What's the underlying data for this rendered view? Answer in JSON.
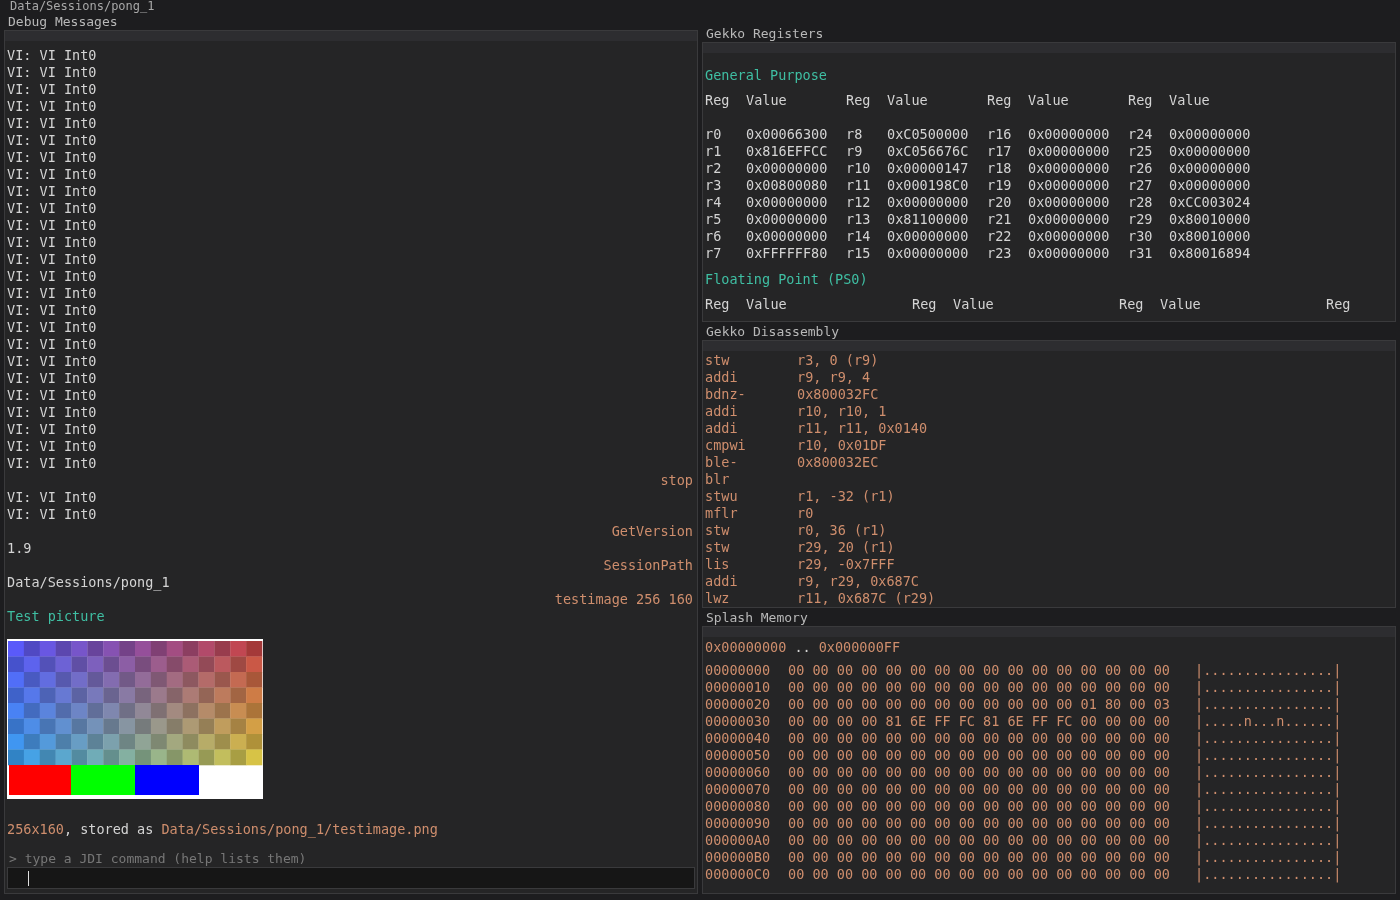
{
  "path_header": "Data/Sessions/pong_1",
  "debug_panel": {
    "title": "Debug Messages",
    "entries": [
      {
        "kind": "log",
        "text": "VI: VI Int0"
      },
      {
        "kind": "log",
        "text": "VI: VI Int0"
      },
      {
        "kind": "log",
        "text": "VI: VI Int0"
      },
      {
        "kind": "log",
        "text": "VI: VI Int0"
      },
      {
        "kind": "log",
        "text": "VI: VI Int0"
      },
      {
        "kind": "log",
        "text": "VI: VI Int0"
      },
      {
        "kind": "log",
        "text": "VI: VI Int0"
      },
      {
        "kind": "log",
        "text": "VI: VI Int0"
      },
      {
        "kind": "log",
        "text": "VI: VI Int0"
      },
      {
        "kind": "log",
        "text": "VI: VI Int0"
      },
      {
        "kind": "log",
        "text": "VI: VI Int0"
      },
      {
        "kind": "log",
        "text": "VI: VI Int0"
      },
      {
        "kind": "log",
        "text": "VI: VI Int0"
      },
      {
        "kind": "log",
        "text": "VI: VI Int0"
      },
      {
        "kind": "log",
        "text": "VI: VI Int0"
      },
      {
        "kind": "log",
        "text": "VI: VI Int0"
      },
      {
        "kind": "log",
        "text": "VI: VI Int0"
      },
      {
        "kind": "log",
        "text": "VI: VI Int0"
      },
      {
        "kind": "log",
        "text": "VI: VI Int0"
      },
      {
        "kind": "log",
        "text": "VI: VI Int0"
      },
      {
        "kind": "log",
        "text": "VI: VI Int0"
      },
      {
        "kind": "log",
        "text": "VI: VI Int0"
      },
      {
        "kind": "log",
        "text": "VI: VI Int0"
      },
      {
        "kind": "log",
        "text": "VI: VI Int0"
      },
      {
        "kind": "log",
        "text": "VI: VI Int0"
      },
      {
        "kind": "command",
        "text": "stop"
      },
      {
        "kind": "log",
        "text": "VI: VI Int0"
      },
      {
        "kind": "log",
        "text": "VI: VI Int0"
      },
      {
        "kind": "command",
        "text": "GetVersion"
      },
      {
        "kind": "log",
        "text": "1.9"
      },
      {
        "kind": "command",
        "text": "SessionPath"
      },
      {
        "kind": "log",
        "text": "Data/Sessions/pong_1"
      },
      {
        "kind": "command",
        "text": "testimage 256 160"
      },
      {
        "kind": "heading",
        "text": "Test picture"
      },
      {
        "kind": "image"
      },
      {
        "kind": "result",
        "parts": [
          {
            "kind": "value",
            "text": "256x160"
          },
          {
            "kind": "plain",
            "text": ", stored as "
          },
          {
            "kind": "value",
            "text": "Data/Sessions/pong_1/testimage.png"
          }
        ]
      }
    ],
    "prompt_hint": "> type a JDI command (help lists them)"
  },
  "registers_panel": {
    "title": "Gekko Registers",
    "general_purpose": {
      "title": "General Purpose",
      "columns": [
        "Reg",
        "Value",
        "Reg",
        "Value",
        "Reg",
        "Value",
        "Reg",
        "Value"
      ],
      "rows": [
        [
          "r0",
          "0x00066300",
          "r8",
          "0xC0500000",
          "r16",
          "0x00000000",
          "r24",
          "0x00000000"
        ],
        [
          "r1",
          "0x816EFFCC",
          "r9",
          "0xC056676C",
          "r17",
          "0x00000000",
          "r25",
          "0x00000000"
        ],
        [
          "r2",
          "0x00000000",
          "r10",
          "0x00000147",
          "r18",
          "0x00000000",
          "r26",
          "0x00000000"
        ],
        [
          "r3",
          "0x00800080",
          "r11",
          "0x000198C0",
          "r19",
          "0x00000000",
          "r27",
          "0x00000000"
        ],
        [
          "r4",
          "0x00000000",
          "r12",
          "0x00000000",
          "r20",
          "0x00000000",
          "r28",
          "0xCC003024"
        ],
        [
          "r5",
          "0x00000000",
          "r13",
          "0x81100000",
          "r21",
          "0x00000000",
          "r29",
          "0x80010000"
        ],
        [
          "r6",
          "0x00000000",
          "r14",
          "0x00000000",
          "r22",
          "0x00000000",
          "r30",
          "0x80010000"
        ],
        [
          "r7",
          "0xFFFFFF80",
          "r15",
          "0x00000000",
          "r23",
          "0x00000000",
          "r31",
          "0x80016894"
        ]
      ]
    },
    "floating_point": {
      "title": "Floating Point (PS0)",
      "columns": [
        "Reg",
        "Value",
        "Reg",
        "Value",
        "Reg",
        "Value",
        "Reg"
      ]
    }
  },
  "disassembly_panel": {
    "title": "Gekko Disassembly",
    "rows": [
      {
        "mnemonic": "stw",
        "operands": "r3, 0 (r9)"
      },
      {
        "mnemonic": "addi",
        "operands": "r9, r9, 4"
      },
      {
        "mnemonic": "bdnz-",
        "operands": "0x800032FC"
      },
      {
        "mnemonic": "addi",
        "operands": "r10, r10, 1"
      },
      {
        "mnemonic": "addi",
        "operands": "r11, r11, 0x0140"
      },
      {
        "mnemonic": "cmpwi",
        "operands": "r10, 0x01DF"
      },
      {
        "mnemonic": "ble-",
        "operands": "0x800032EC"
      },
      {
        "mnemonic": "blr"
      },
      {
        "mnemonic": "stwu",
        "operands": "r1, -32 (r1)"
      },
      {
        "mnemonic": "mflr",
        "operands": "r0"
      },
      {
        "mnemonic": "stw",
        "operands": "r0, 36 (r1)"
      },
      {
        "mnemonic": "stw",
        "operands": "r29, 20 (r1)"
      },
      {
        "mnemonic": "lis",
        "operands": "r29, -0x7FFF"
      },
      {
        "mnemonic": "addi",
        "operands": "r9, r29, 0x687C"
      },
      {
        "mnemonic": "lwz",
        "operands": "r11, 0x687C (r29)"
      }
    ]
  },
  "memory_panel": {
    "title": "Splash Memory",
    "range_start": "0x00000000",
    "range_separator": "..",
    "range_end": "0x000000FF",
    "rows": [
      {
        "address": "00000000",
        "bytes": "00 00 00 00 00 00 00 00 00 00 00 00 00 00 00 00",
        "ascii": "|................|"
      },
      {
        "address": "00000010",
        "bytes": "00 00 00 00 00 00 00 00 00 00 00 00 00 00 00 00",
        "ascii": "|................|"
      },
      {
        "address": "00000020",
        "bytes": "00 00 00 00 00 00 00 00 00 00 00 00 01 80 00 03",
        "ascii": "|................|"
      },
      {
        "address": "00000030",
        "bytes": "00 00 00 00 81 6E FF FC 81 6E FF FC 00 00 00 00",
        "ascii": "|.....n...n......|"
      },
      {
        "address": "00000040",
        "bytes": "00 00 00 00 00 00 00 00 00 00 00 00 00 00 00 00",
        "ascii": "|................|"
      },
      {
        "address": "00000050",
        "bytes": "00 00 00 00 00 00 00 00 00 00 00 00 00 00 00 00",
        "ascii": "|................|"
      },
      {
        "address": "00000060",
        "bytes": "00 00 00 00 00 00 00 00 00 00 00 00 00 00 00 00",
        "ascii": "|................|"
      },
      {
        "address": "00000070",
        "bytes": "00 00 00 00 00 00 00 00 00 00 00 00 00 00 00 00",
        "ascii": "|................|"
      },
      {
        "address": "00000080",
        "bytes": "00 00 00 00 00 00 00 00 00 00 00 00 00 00 00 00",
        "ascii": "|................|"
      },
      {
        "address": "00000090",
        "bytes": "00 00 00 00 00 00 00 00 00 00 00 00 00 00 00 00",
        "ascii": "|................|"
      },
      {
        "address": "000000A0",
        "bytes": "00 00 00 00 00 00 00 00 00 00 00 00 00 00 00 00",
        "ascii": "|................|"
      },
      {
        "address": "000000B0",
        "bytes": "00 00 00 00 00 00 00 00 00 00 00 00 00 00 00 00",
        "ascii": "|................|"
      },
      {
        "address": "000000C0",
        "bytes": "00 00 00 00 00 00 00 00 00 00 00 00 00 00 00 00",
        "ascii": "|................|"
      }
    ]
  }
}
